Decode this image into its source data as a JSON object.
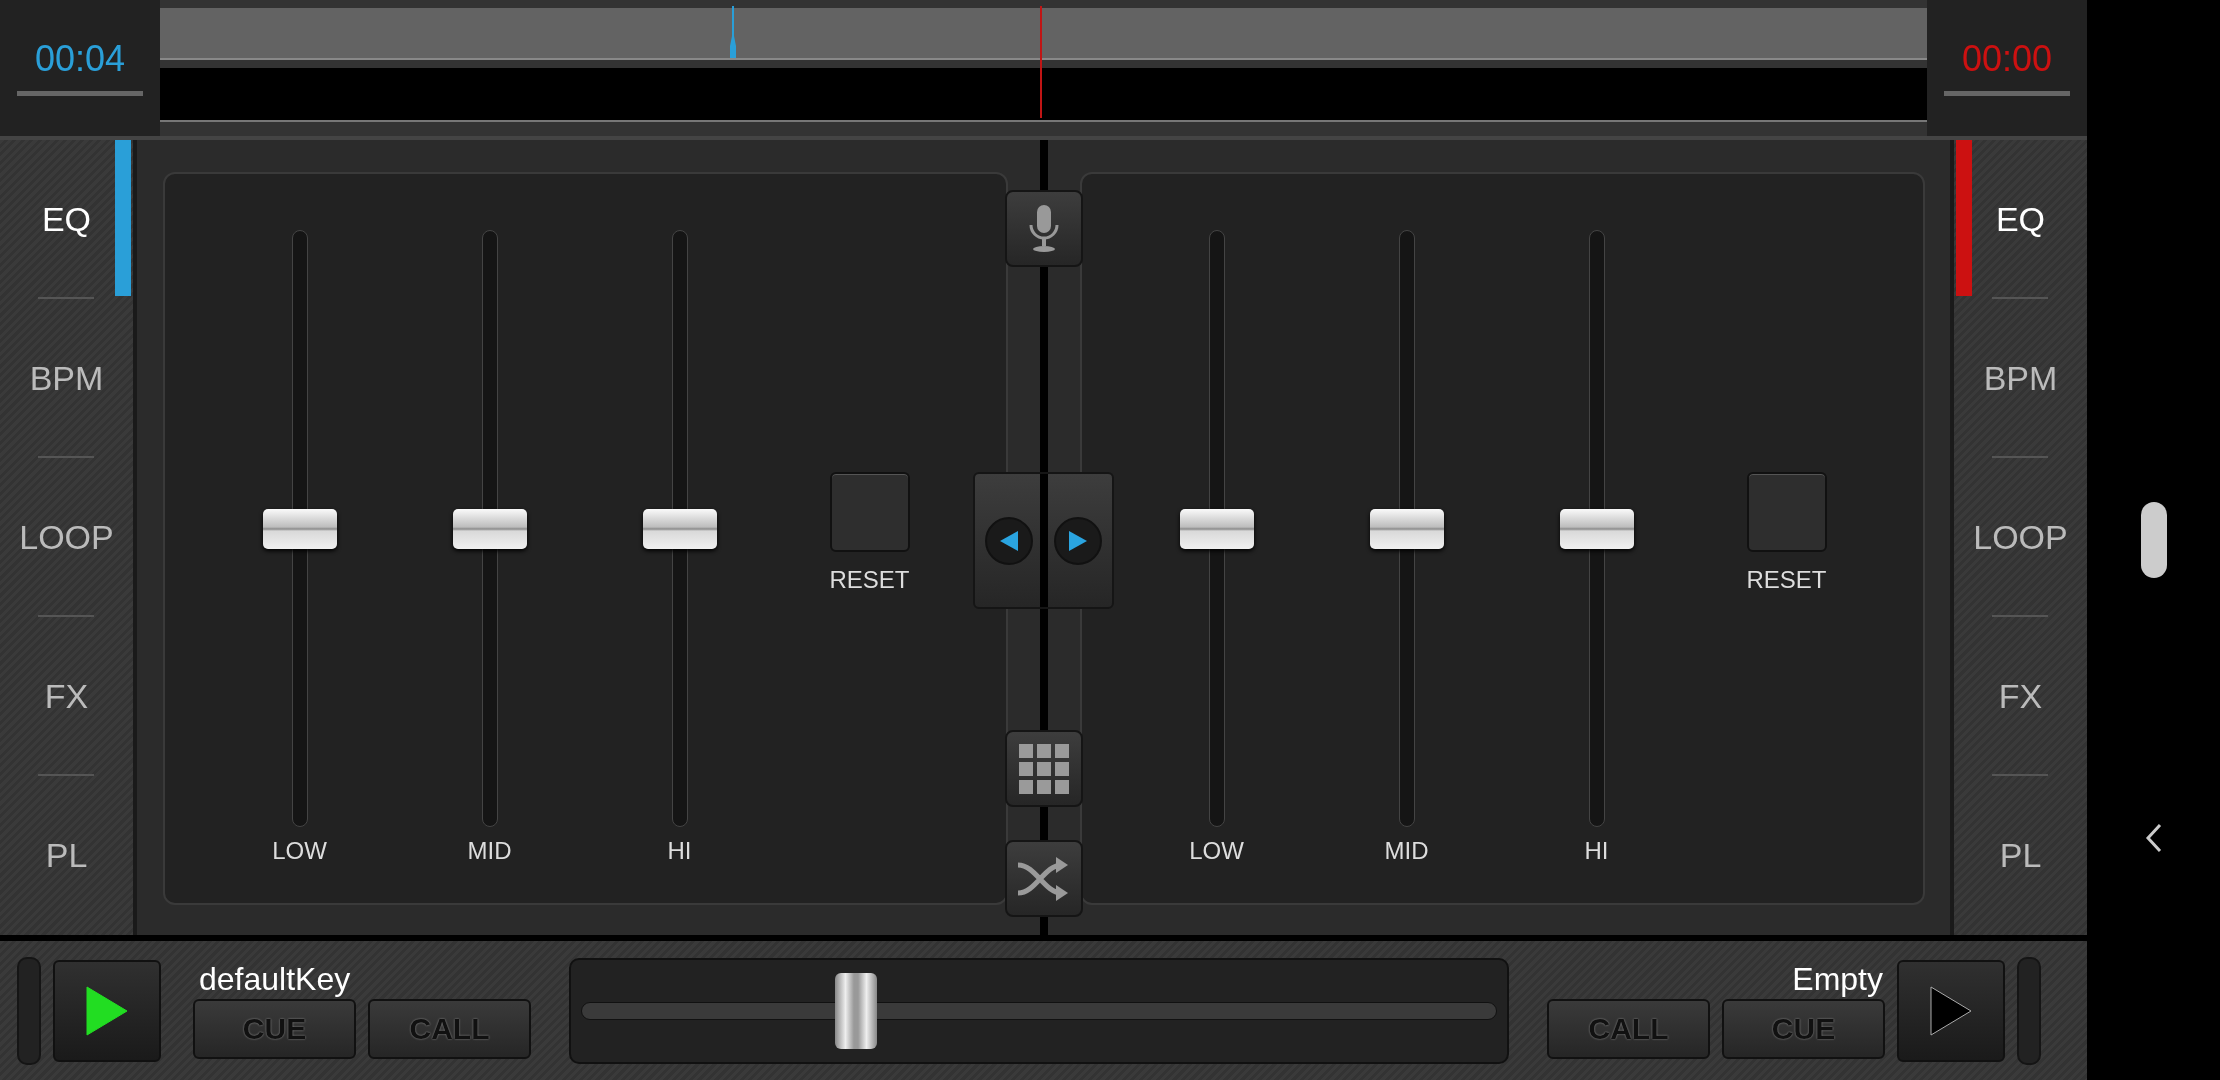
{
  "decks": [
    {
      "time": "00:04",
      "color": "#2a9fd8",
      "tabs": [
        {
          "label": "EQ",
          "selected": true
        },
        {
          "label": "BPM",
          "selected": false
        },
        {
          "label": "LOOP",
          "selected": false
        },
        {
          "label": "FX",
          "selected": false
        },
        {
          "label": "PL",
          "selected": false
        }
      ],
      "eq": [
        {
          "label": "LOW",
          "level": 0.5
        },
        {
          "label": "MID",
          "level": 0.5
        },
        {
          "label": "HI",
          "level": 0.5
        }
      ],
      "reset": "RESET",
      "track": "defaultKey",
      "play_active": true,
      "buttons": [
        "CUE",
        "CALL"
      ]
    },
    {
      "time": "00:00",
      "color": "#cc1111",
      "tabs": [
        {
          "label": "EQ",
          "selected": true
        },
        {
          "label": "BPM",
          "selected": false
        },
        {
          "label": "LOOP",
          "selected": false
        },
        {
          "label": "FX",
          "selected": false
        },
        {
          "label": "PL",
          "selected": false
        }
      ],
      "eq": [
        {
          "label": "LOW",
          "level": 0.5
        },
        {
          "label": "MID",
          "level": 0.5
        },
        {
          "label": "HI",
          "level": 0.5
        }
      ],
      "reset": "RESET",
      "track": "Empty",
      "play_active": false,
      "buttons": [
        "CALL",
        "CUE"
      ]
    }
  ],
  "crossfader": {
    "level": 0.3
  }
}
